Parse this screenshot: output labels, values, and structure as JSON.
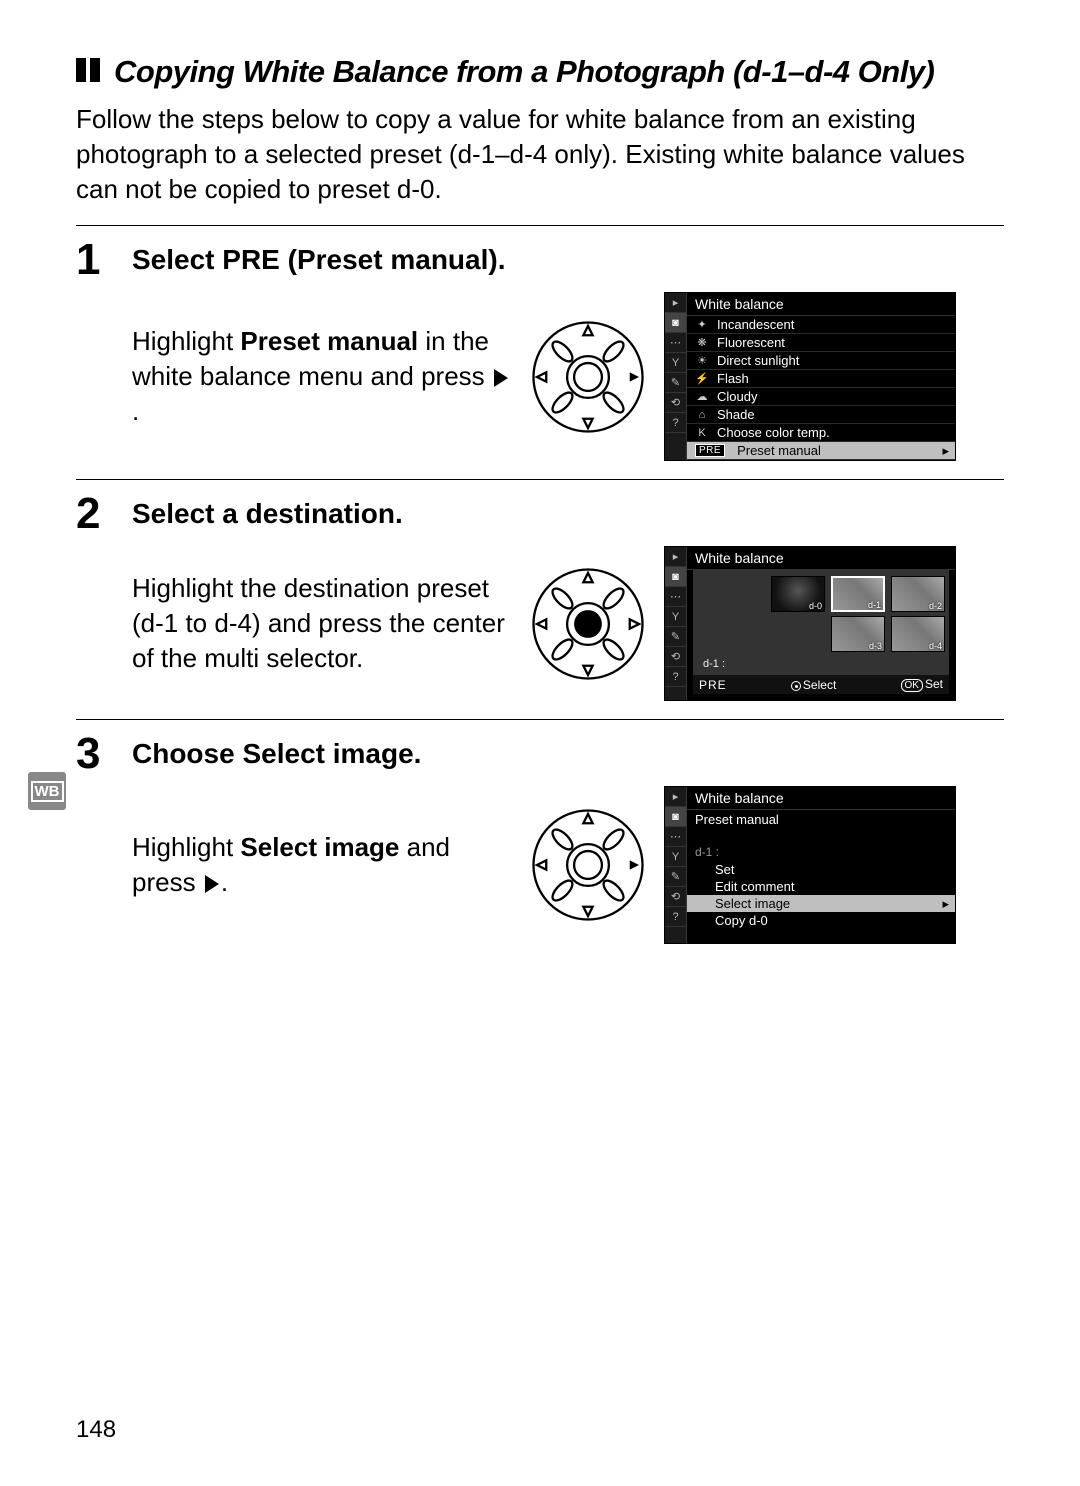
{
  "page_number": "148",
  "heading": "Copying White Balance from a Photograph (d-1–d-4 Only)",
  "intro": "Follow the steps below to copy a value for white balance from an existing photograph to a selected preset (d-1–d-4 only).  Existing white balance values can not be copied to preset d-0.",
  "wb_tab": "WB",
  "steps": [
    {
      "num": "1",
      "title_pre": "Select ",
      "title_sc": "PRE",
      "title_post": " (Preset manual).",
      "text_pre": "Highlight ",
      "text_bold": "Preset manual",
      "text_post": " in the white balance menu and press ",
      "wheel_right_fill": true,
      "lcd": {
        "title": "White balance",
        "sidebar": [
          "▸",
          "◙",
          "⋯",
          "Y",
          "✎",
          "⟲",
          "?"
        ],
        "items": [
          {
            "icon": "✦",
            "label": "Incandescent"
          },
          {
            "icon": "❋",
            "label": "Fluorescent"
          },
          {
            "icon": "☀",
            "label": "Direct sunlight"
          },
          {
            "icon": "⚡",
            "label": "Flash"
          },
          {
            "icon": "☁",
            "label": "Cloudy"
          },
          {
            "icon": "⌂",
            "label": "Shade"
          },
          {
            "icon": "K",
            "label": "Choose color temp."
          },
          {
            "icon": "PRE",
            "label": "Preset manual",
            "selected": true
          }
        ]
      }
    },
    {
      "num": "2",
      "title": "Select a destination.",
      "text": "Highlight the destination preset (d-1 to d-4) and press the center of the multi selector.",
      "wheel_center_fill": false,
      "lcd": {
        "title": "White balance",
        "sidebar": [
          "▸",
          "◙",
          "⋯",
          "Y",
          "✎",
          "⟲",
          "?"
        ],
        "presets": [
          {
            "label": "d-0",
            "class": "d0"
          },
          {
            "label": "d-1",
            "class": "sel"
          },
          {
            "label": "d-2",
            "class": ""
          },
          {
            "label": "d-3",
            "class": ""
          },
          {
            "label": "d-4",
            "class": ""
          }
        ],
        "status": "d-1  :",
        "footer_pre": "PRE",
        "footer_select": "Select",
        "footer_set": "Set"
      }
    },
    {
      "num": "3",
      "title_pre": "Choose ",
      "title_bold": "Select image",
      "title_post": ".",
      "text_pre": "Highlight ",
      "text_bold": "Select image",
      "text_post": " and press ",
      "wheel_right_fill": true,
      "lcd": {
        "title": "White balance",
        "subtitle": "Preset manual",
        "sidebar": [
          "▸",
          "◙",
          "⋯",
          "Y",
          "✎",
          "⟲",
          "?"
        ],
        "preset_label": "d-1         :",
        "items": [
          {
            "label": "Set"
          },
          {
            "label": "Edit comment"
          },
          {
            "label": "Select image",
            "selected": true
          },
          {
            "label": "Copy d-0"
          }
        ]
      }
    }
  ]
}
